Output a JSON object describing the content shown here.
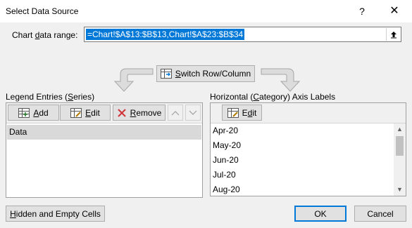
{
  "window": {
    "title": "Select Data Source",
    "help": "?",
    "close": "✕"
  },
  "range": {
    "label": "Chart data range:",
    "value": "=Chart!$A$13:$B$13,Chart!$A$23:$B$34"
  },
  "switch_button": {
    "label": "Switch Row/Column"
  },
  "legend": {
    "label": "Legend Entries (Series)",
    "add": "Add",
    "edit": "Edit",
    "remove": "Remove",
    "series": [
      "Data"
    ]
  },
  "axis": {
    "label": "Horizontal (Category) Axis Labels",
    "edit": "Edit",
    "items": [
      "Apr-20",
      "May-20",
      "Jun-20",
      "Jul-20",
      "Aug-20"
    ]
  },
  "footer": {
    "hidden_cells": "Hidden and Empty Cells",
    "ok": "OK",
    "cancel": "Cancel"
  },
  "colors": {
    "accent": "#0078d7",
    "remove_icon": "#d13438",
    "selected_row": "#d9d9d9"
  }
}
